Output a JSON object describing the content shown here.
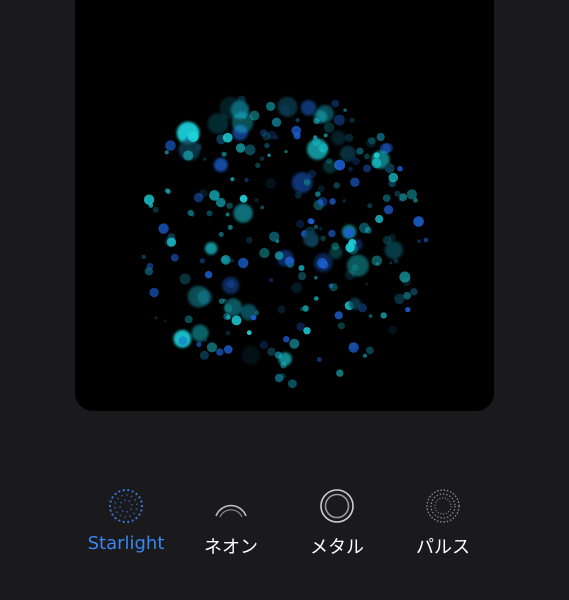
{
  "preview": {
    "effect": "starlight-particles",
    "background_color": "#000000",
    "particle_colors": [
      "#1fd3dd",
      "#15a6b4",
      "#0e6f82",
      "#1b5fcf",
      "#0b3f55"
    ]
  },
  "accent_color": "#3a86f0",
  "styles": [
    {
      "label": "Starlight",
      "icon": "starlight-icon",
      "selected": true
    },
    {
      "label": "ネオン",
      "icon": "neon-icon",
      "selected": false
    },
    {
      "label": "メタル",
      "icon": "metal-icon",
      "selected": false
    },
    {
      "label": "パルス",
      "icon": "pulse-icon",
      "selected": false
    }
  ]
}
